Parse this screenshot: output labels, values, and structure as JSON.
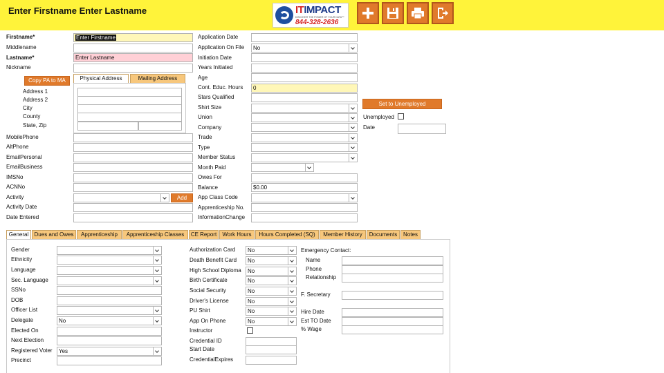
{
  "header": {
    "title": "Enter Firstname  Enter Lastname",
    "logo": {
      "brand_it": "IT",
      "brand_rest": "IMPACT",
      "tagline": "DISCOVER THE POWER OF YOUR DATA™",
      "phone": "844-328-2636"
    },
    "toolbar": {
      "add": "plus-icon",
      "save": "floppy-disk-icon",
      "print": "printer-icon",
      "exit": "exit-icon"
    }
  },
  "left": {
    "firstname_label": "Firstname*",
    "firstname_value": "Enter Firstname",
    "middlename_label": "Middlename",
    "lastname_label": "Lastname*",
    "lastname_value": "Enter Lastname",
    "nickname_label": "Nickname",
    "copy_button": "Copy PA to MA",
    "address_tabs": [
      "Physical Address",
      "Mailing Address"
    ],
    "address_labels": [
      "Address 1",
      "Address 2",
      "City",
      "County",
      "State, Zip"
    ],
    "mobile_label": "MobilePhone",
    "alt_label": "AltPhone",
    "email_personal_label": "EmailPersonal",
    "email_business_label": "EmailBusiness",
    "ims_label": "IMSNo",
    "acn_label": "ACNNo",
    "activity_label": "Activity",
    "add_button": "Add",
    "activity_date_label": "Activity Date",
    "date_entered_label": "Date Entered"
  },
  "middle": {
    "labels": [
      "Application Date",
      "Application On File",
      "Initiation Date",
      "Years Initiated",
      "Age",
      "Cont. Educ. Hours",
      "Stars Qualified",
      "Shirt Size",
      "Union",
      "Company",
      "Trade",
      "Type",
      "Member Status",
      "Month Paid",
      "Owes For",
      "Balance",
      "App Class Code",
      "Apprenticeship No.",
      "InformationChange"
    ],
    "application_on_file_value": "No",
    "cont_educ_value": "0",
    "balance_value": "$0.00"
  },
  "right": {
    "set_unemployed_button": "Set to Unemployed",
    "unemployed_label": "Unemployed",
    "date_label": "Date"
  },
  "tabs": [
    "General",
    "Dues and Owes",
    "Apprenticeship",
    "Apprenticeship Classes",
    "CE Report",
    "Work Hours",
    "Hours Completed (SQ)",
    "Member History",
    "Documents",
    "Notes"
  ],
  "general": {
    "col1_labels": [
      "Gender",
      "Ethnicity",
      "Language",
      "Sec. Language",
      "SSNo",
      "DOB",
      "Officer List",
      "Delegate",
      "Elected On",
      "Next Election",
      "Registered Voter",
      "Precinct"
    ],
    "delegate_value": "No",
    "registered_voter_value": "Yes",
    "col2_labels": [
      "Authorization Card",
      "Death Benefit Card",
      "High School Diploma",
      "Birth Certificate",
      "Social Security",
      "Driver's License",
      "PU Shirt",
      "App On Phone",
      "Instructor",
      "Credential ID",
      "Start Date",
      "CredentialExpires"
    ],
    "col2_values": [
      "No",
      "No",
      "No",
      "No",
      "No",
      "No",
      "No",
      "No"
    ],
    "emergency_title": "Emergency Contact:",
    "emergency_labels": [
      "Name",
      "Phone",
      "Relationship"
    ],
    "f_secretary_label": "F. Secretary",
    "hire_labels": [
      "Hire Date",
      "Est TO Date",
      "% Wage"
    ]
  }
}
